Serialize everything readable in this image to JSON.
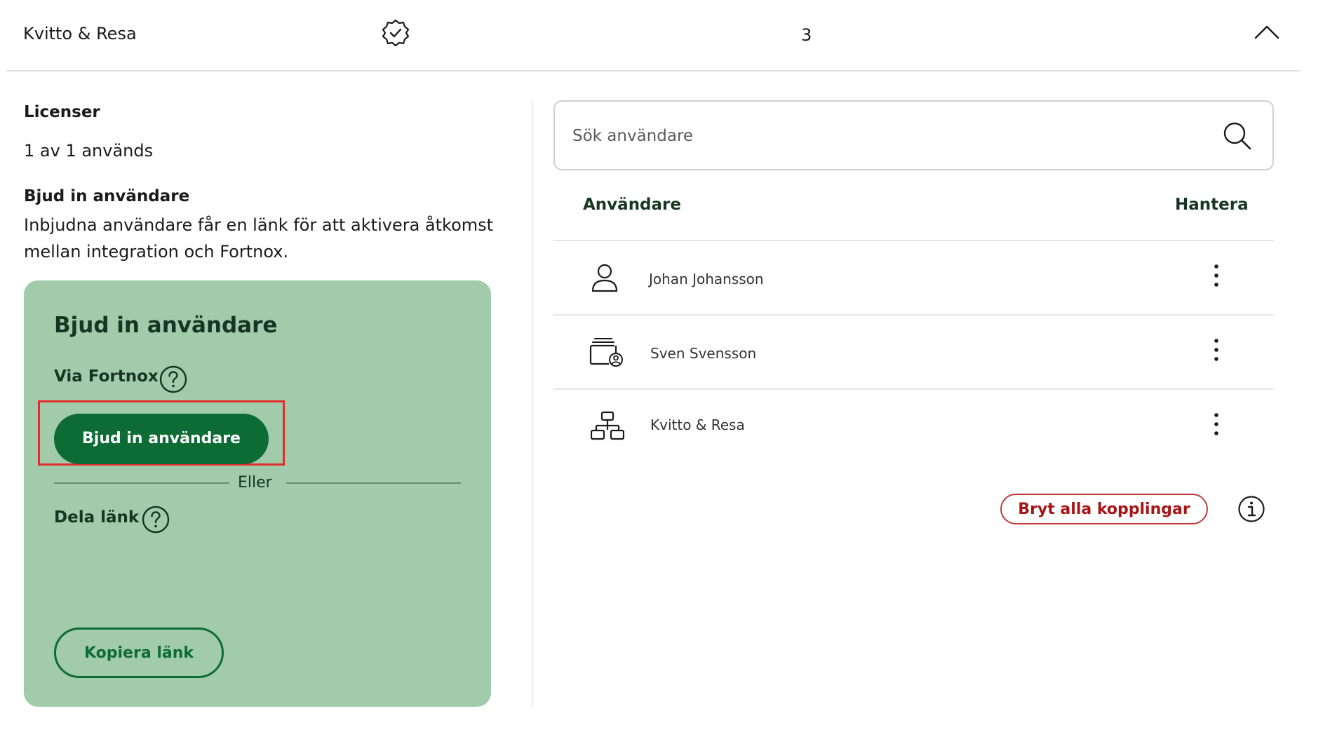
{
  "header": {
    "title": "Kvitto & Resa",
    "count": "3"
  },
  "licenses": {
    "heading": "Licenser",
    "usage": "1 av 1 används"
  },
  "invite_info": {
    "heading": "Bjud in användare",
    "description": "Inbjudna användare får en länk för att aktivera åtkomst mellan integration och Fortnox."
  },
  "invite_card": {
    "title": "Bjud in användare",
    "via_label": "Via Fortnox",
    "invite_button": "Bjud in användare",
    "or_text": "Eller",
    "share_label": "Dela länk",
    "copy_button": "Kopiera länk"
  },
  "search": {
    "placeholder": "Sök användare"
  },
  "table": {
    "col_users": "Användare",
    "col_manage": "Hantera",
    "rows": [
      {
        "name": "Johan Johansson",
        "icon": "user-icon"
      },
      {
        "name": "Sven Svensson",
        "icon": "user-stack-icon"
      },
      {
        "name": "Kvitto & Resa",
        "icon": "network-icon"
      }
    ]
  },
  "actions": {
    "disconnect_all": "Bryt alla kopplingar"
  },
  "colors": {
    "primary_green": "#0d6b35",
    "card_green": "#a1cbab",
    "danger_red": "#a61515",
    "highlight_red": "#e32b2b"
  }
}
